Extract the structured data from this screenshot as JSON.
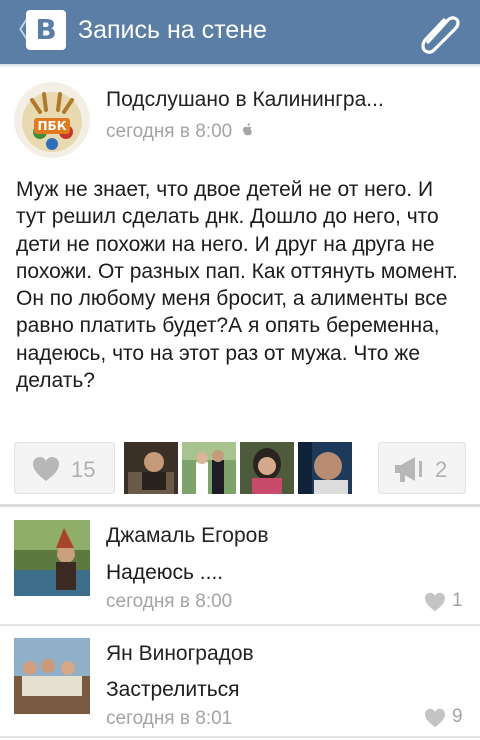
{
  "header": {
    "back_glyph": "〈",
    "logo_letter": "B",
    "title": "Запись на стене",
    "attach_icon": "paperclip-icon",
    "bg_color": "#5a7ea6"
  },
  "post": {
    "group_name": "Подслушано в Калинингра...",
    "time": "сегодня в 8:00",
    "platform_icon": "apple-icon",
    "avatar_text": "ПБК",
    "text": "Муж не знает, что двое детей не от него. И тут решил сделать днк. Дошло до него, что дети не похожи на него. И друг на друга не похожи. От разных пап. Как оттянуть момент. Он по любому меня бросит, а алименты все равно платить будет?А я опять беременна, надеюсь, что на этот раз от мужа. Что же делать?",
    "likes": "15",
    "shares": "2",
    "liker_count": 4
  },
  "comments": [
    {
      "author": "Джамаль Егоров",
      "text": "Надеюсь ....",
      "time": "сегодня в 8:00",
      "likes": "1"
    },
    {
      "author": "Ян Виноградов",
      "text": "Застрелиться",
      "time": "сегодня в 8:01",
      "likes": "9"
    }
  ]
}
